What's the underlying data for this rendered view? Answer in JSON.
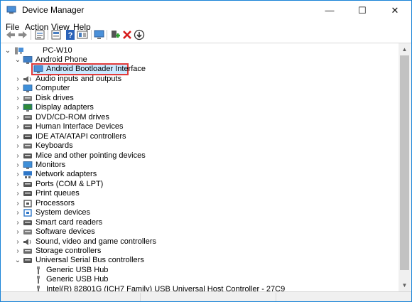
{
  "window": {
    "title": "Device Manager",
    "minimize": "—",
    "maximize": "☐",
    "close": "✕"
  },
  "menu": [
    "File",
    "Action",
    "View",
    "Help"
  ],
  "toolbar": [
    "back-icon",
    "forward-icon",
    "properties-icon",
    "update-driver-icon",
    "help-icon",
    "show-hidden-icon",
    "scan-hardware-icon",
    "enable-device-icon",
    "uninstall-icon",
    "update-icon"
  ],
  "tree": {
    "root": "PC-W10",
    "items": [
      {
        "label": "Android Phone",
        "state": "expanded",
        "level": 1,
        "icon": "phone-icon"
      },
      {
        "label": "Android Bootloader Interface",
        "state": "leaf",
        "level": 2,
        "icon": "device-icon",
        "selected": true
      },
      {
        "label": "Audio inputs and outputs",
        "state": "collapsed",
        "level": 1,
        "icon": "speaker-icon"
      },
      {
        "label": "Computer",
        "state": "collapsed",
        "level": 1,
        "icon": "monitor-icon"
      },
      {
        "label": "Disk drives",
        "state": "collapsed",
        "level": 1,
        "icon": "disk-icon"
      },
      {
        "label": "Display adapters",
        "state": "collapsed",
        "level": 1,
        "icon": "display-adapter-icon"
      },
      {
        "label": "DVD/CD-ROM drives",
        "state": "collapsed",
        "level": 1,
        "icon": "dvd-icon"
      },
      {
        "label": "Human Interface Devices",
        "state": "collapsed",
        "level": 1,
        "icon": "hid-icon"
      },
      {
        "label": "IDE ATA/ATAPI controllers",
        "state": "collapsed",
        "level": 1,
        "icon": "ide-icon"
      },
      {
        "label": "Keyboards",
        "state": "collapsed",
        "level": 1,
        "icon": "keyboard-icon"
      },
      {
        "label": "Mice and other pointing devices",
        "state": "collapsed",
        "level": 1,
        "icon": "mouse-icon"
      },
      {
        "label": "Monitors",
        "state": "collapsed",
        "level": 1,
        "icon": "monitor-icon"
      },
      {
        "label": "Network adapters",
        "state": "collapsed",
        "level": 1,
        "icon": "network-icon"
      },
      {
        "label": "Ports (COM & LPT)",
        "state": "collapsed",
        "level": 1,
        "icon": "port-icon"
      },
      {
        "label": "Print queues",
        "state": "collapsed",
        "level": 1,
        "icon": "printer-icon"
      },
      {
        "label": "Processors",
        "state": "collapsed",
        "level": 1,
        "icon": "processor-icon"
      },
      {
        "label": "System devices",
        "state": "collapsed",
        "level": 1,
        "icon": "system-icon"
      },
      {
        "label": "Smart card readers",
        "state": "collapsed",
        "level": 1,
        "icon": "card-reader-icon"
      },
      {
        "label": "Software devices",
        "state": "collapsed",
        "level": 1,
        "icon": "software-icon"
      },
      {
        "label": "Sound, video and game controllers",
        "state": "collapsed",
        "level": 1,
        "icon": "sound-icon"
      },
      {
        "label": "Storage controllers",
        "state": "collapsed",
        "level": 1,
        "icon": "storage-icon"
      },
      {
        "label": "Universal Serial Bus controllers",
        "state": "expanded",
        "level": 1,
        "icon": "usb-icon"
      },
      {
        "label": "Generic USB Hub",
        "state": "leaf",
        "level": 2,
        "icon": "usb-plug-icon"
      },
      {
        "label": "Generic USB Hub",
        "state": "leaf",
        "level": 2,
        "icon": "usb-plug-icon"
      },
      {
        "label": "Intel(R) 82801G (ICH7 Family) USB Universal Host Controller - 27C9",
        "state": "leaf",
        "level": 2,
        "icon": "usb-plug-icon"
      }
    ]
  },
  "colors": {
    "selection_border": "#e23b3b",
    "selection_fill": "#cce8ff",
    "window_border": "#1883d7"
  }
}
